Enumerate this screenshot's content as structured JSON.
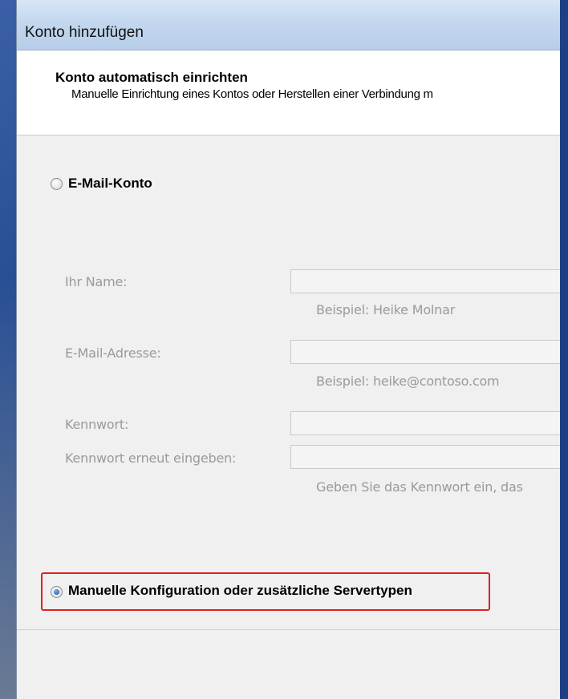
{
  "window": {
    "title": "Konto hinzufügen"
  },
  "header": {
    "title": "Konto automatisch einrichten",
    "subtitle": "Manuelle Einrichtung eines Kontos oder Herstellen einer Verbindung m"
  },
  "options": {
    "email_account": {
      "label": "E-Mail-Konto",
      "selected": false
    },
    "manual_config": {
      "label": "Manuelle Konfiguration oder zusätzliche Servertypen",
      "selected": true
    }
  },
  "fields": {
    "name": {
      "label": "Ihr Name:",
      "value": "",
      "hint": "Beispiel: Heike Molnar"
    },
    "email": {
      "label": "E-Mail-Adresse:",
      "value": "",
      "hint": "Beispiel: heike@contoso.com"
    },
    "password": {
      "label": "Kennwort:",
      "value": ""
    },
    "password_repeat": {
      "label": "Kennwort erneut eingeben:",
      "value": "",
      "hint": "Geben Sie das Kennwort ein, das"
    }
  },
  "colors": {
    "highlight": "#e02020",
    "radio_selected": "#2a6ab8",
    "disabled_text": "#9a9a9a"
  }
}
